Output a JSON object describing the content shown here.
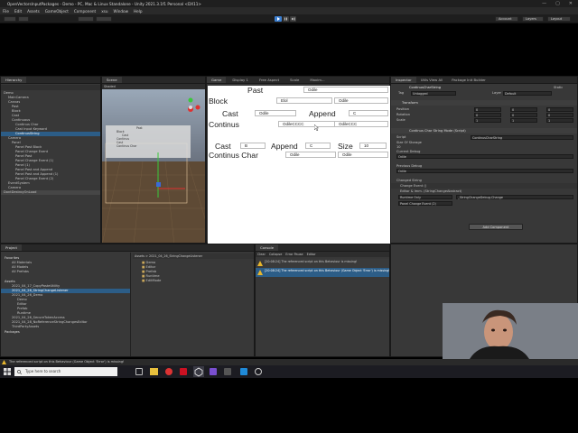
{
  "window": {
    "title": "OpenVectorsInputPackages - Demo - PC, Mac & Linux Standalone - Unity 2021.3.1f1 Personal <DX11>",
    "controls": [
      "—",
      "▢",
      "✕"
    ]
  },
  "menu": [
    "File",
    "Edit",
    "Assets",
    "GameObject",
    "Component",
    "xsu",
    "Window",
    "Help"
  ],
  "toolbar": {
    "account": "Account",
    "layers": "Layers",
    "layout": "Layout"
  },
  "hierarchy": {
    "tab": "Hierarchy",
    "scene": "Demo",
    "items": [
      "Demo",
      "MainCamera",
      "Canvas",
      "Past",
      "Block",
      "Cast",
      "Continuous",
      "Continus Char",
      "ContinusString",
      "Cast Input Keyword",
      "Camera",
      "Panel",
      "Panel Past Block",
      "Panel Change Event",
      "Panel Past",
      "Panel Change Event (1)",
      "Panel (1)",
      "Panel Past and Append",
      "Panel Past and Append (1)",
      "Panel Change Event (2)",
      "EventSystem",
      "Camera",
      "DontDestroyOnLoad"
    ]
  },
  "scene": {
    "tab": "Scene",
    "mode": "Shaded",
    "persp": "< Persp"
  },
  "game": {
    "tab": "Game",
    "display": "Display 1",
    "aspect": "Free Aspect",
    "scale": "Scale",
    "maximize": "Maxim...",
    "rows": [
      {
        "label": "Past",
        "value": "Odile"
      },
      {
        "label": "Block",
        "v1": "Elol",
        "v2": "Odile"
      },
      {
        "label": "Cast",
        "v1": "Odile",
        "label2": "Append",
        "v2": "C"
      },
      {
        "label": "Continus",
        "v1": "OdileCCCC",
        "v2": "OdileCCC"
      },
      {
        "label": "Cast",
        "v1": "B",
        "label2": "Append",
        "v2": "C",
        "label3": "Size",
        "v3": "10"
      },
      {
        "label": "Continus Char",
        "v1": "Odile",
        "v2": "Odile"
      }
    ]
  },
  "inspector": {
    "tabs": [
      "Inspector",
      "Utils View All",
      "Package Init Builder"
    ],
    "object": "ContinusCharString",
    "static": "Static",
    "tag_label": "Tag",
    "tag": "Untagged",
    "layer_label": "Layer",
    "layer": "Default",
    "transform": "Transform",
    "position": "Position",
    "rotation": "Rotation",
    "scale": "Scale",
    "pos": [
      "0",
      "0",
      "0"
    ],
    "rot": [
      "0",
      "0",
      "0"
    ],
    "scl": [
      "1",
      "1",
      "1"
    ],
    "script_comp": "Continus Char String Mode (Script)",
    "script_label": "Script",
    "script": "ContinusCharString",
    "size_label": "Size Of Storage",
    "size": "10",
    "current_label": "Current Debug",
    "current": "Odile",
    "previous_label": "Previous Debug",
    "previous": "Odile",
    "changed_label": "Changed String",
    "event_header": "Change Event ()",
    "event_sub": "Editor & Imm. (StringChangeAbstract)",
    "runtime": "Runtime Only",
    "func": "_StringChangeDebug.Change",
    "obj": "Panel Change Event (2)",
    "add_component": "Add Component"
  },
  "project": {
    "tab": "Project",
    "favorites": "Favorites",
    "fav_items": [
      "All Materials",
      "All Models",
      "All Prefabs"
    ],
    "assets": "Assets",
    "asset_items": [
      "2021_04_17_CopyPasteUtility",
      "2021_04_26_StringChangeListener",
      "2021_04_26_Demo",
      "Demo",
      "Editor",
      "Prefab",
      "Runtime",
      "2021_04_26_SecureTokenAccess",
      "2021_04_28_NoReferenceStringChangesEditor",
      "ThirdPartyAssets"
    ],
    "packages": "Packages",
    "breadcrumb": "Assets > 2021_04_26_StringChangeListener",
    "folders": [
      "Demo",
      "Editor",
      "Prefab",
      "Runtime",
      "EditMode"
    ]
  },
  "console": {
    "tab": "Console",
    "buttons": [
      "Clear",
      "Collapse",
      "Error Pause",
      "Editor"
    ],
    "messages": [
      "[20:08:24] The referenced script on this Behaviour is missing!",
      "[20:08:24] The referenced script on this Behaviour (Game Object 'Error') is missing!"
    ]
  },
  "status": "The referenced script on this Behaviour (Game Object 'Error') is missing!",
  "taskbar": {
    "search": "Type here to search"
  }
}
